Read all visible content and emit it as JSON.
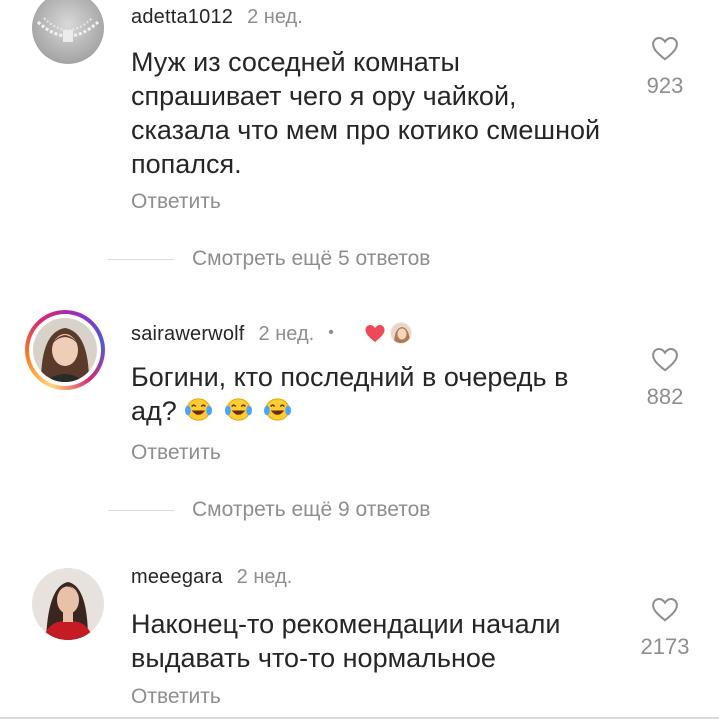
{
  "comments": [
    {
      "username": "adetta1012",
      "time": "2 нед.",
      "text": "Муж из соседней комнаты спрашивает чего я ору чайкой, сказала что мем про котико смешной попался.",
      "likes": "923",
      "reply_label": "Ответить",
      "avatar_icon": "avatar-jewelry-photo"
    },
    {
      "username": "sairawerwolf",
      "time": "2 нед.",
      "separator": "•",
      "author_liked": true,
      "text": "Богини, кто последний в очередь в ад?",
      "emojis": [
        "face-with-tears-of-joy",
        "face-with-tears-of-joy",
        "face-with-tears-of-joy"
      ],
      "likes": "882",
      "reply_label": "Ответить",
      "avatar_icon": "avatar-woman-photo",
      "has_story_ring": true
    },
    {
      "username": "meeegara",
      "time": "2 нед.",
      "text": "Наконец-то рекомендации начали выдавать что-то нормальное",
      "likes": "2173",
      "reply_label": "Ответить",
      "avatar_icon": "avatar-woman-red-dress-photo"
    }
  ],
  "view_replies": [
    "Смотреть ещё 5 ответов",
    "Смотреть ещё 9 ответов"
  ],
  "colors": {
    "text": "#262626",
    "secondary": "#8e8e8e",
    "heart_red": "#ed4956",
    "divider": "#dbdbdb"
  }
}
